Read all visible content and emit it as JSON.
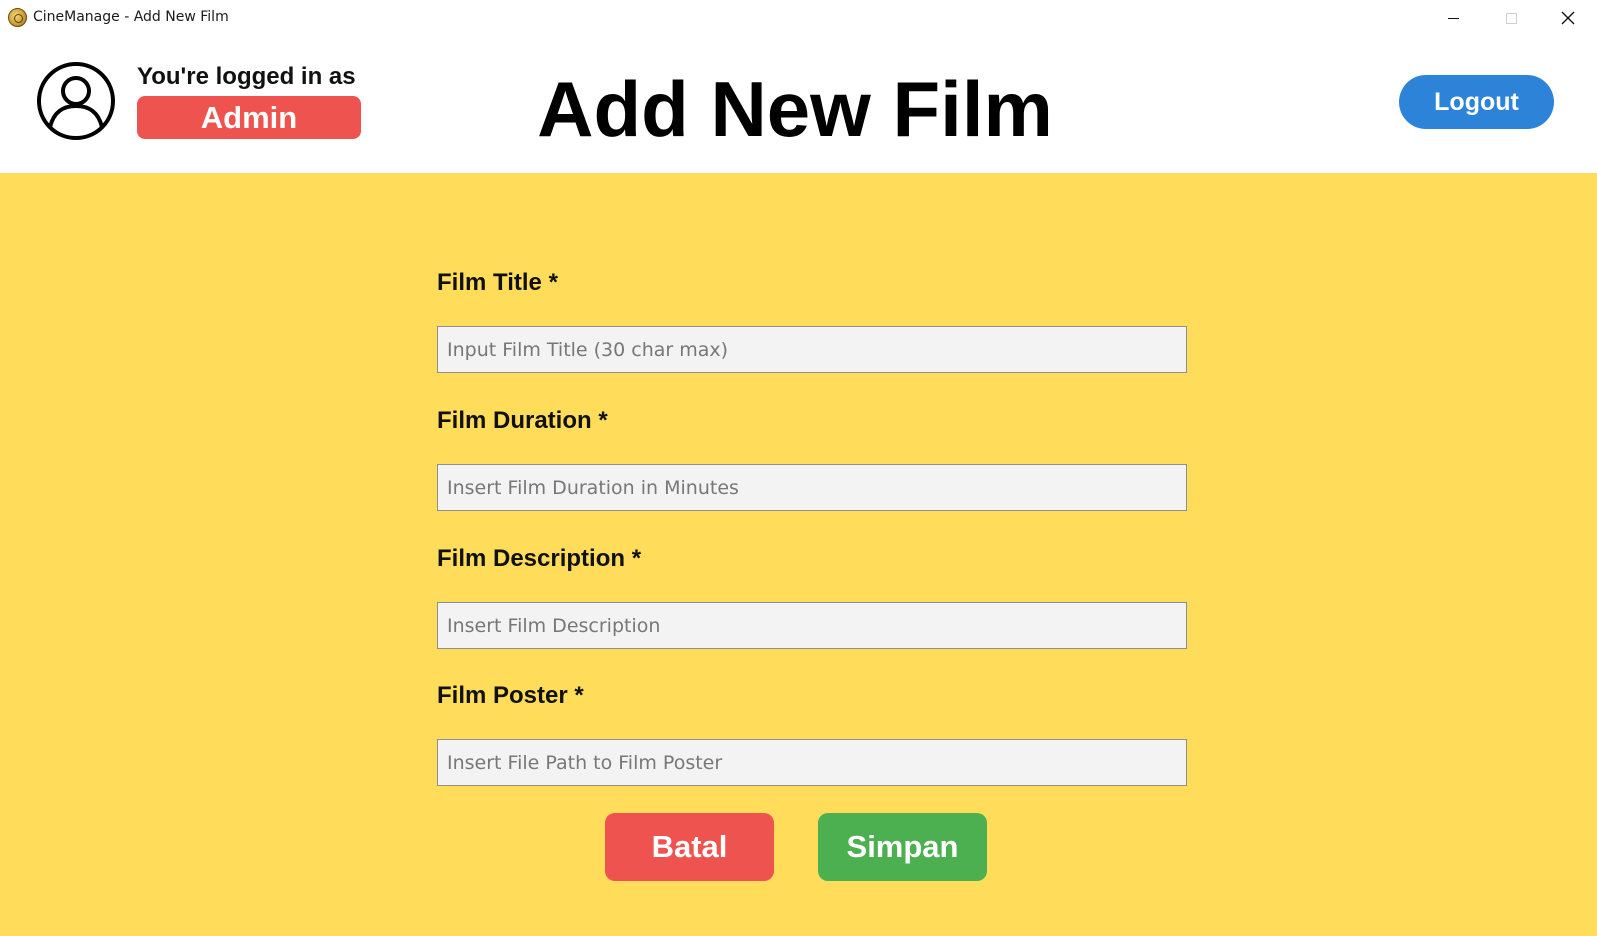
{
  "window": {
    "title": "CineManage - Add New Film",
    "controls": [
      "minimize",
      "maximize",
      "close"
    ]
  },
  "header": {
    "logged_in_text": "You're logged in as",
    "role": "Admin",
    "page_title": "Add New Film",
    "logout_label": "Logout"
  },
  "form": {
    "title_label": "Film Title *",
    "title_placeholder": "Input Film Title (30 char max)",
    "duration_label": "Film Duration *",
    "duration_placeholder": "Insert Film Duration in Minutes",
    "description_label": "Film Description *",
    "description_placeholder": "Insert Film Description",
    "poster_label": "Film Poster *",
    "poster_placeholder": "Insert File Path to Film Poster",
    "cancel_label": "Batal",
    "save_label": "Simpan"
  },
  "colors": {
    "background": "#ffdc5a",
    "role_badge": "#ef5350",
    "logout": "#2d83d8",
    "cancel": "#ef5350",
    "save": "#4caf50"
  },
  "icons": {
    "app": "film-reel-icon",
    "avatar": "user-avatar-icon"
  }
}
